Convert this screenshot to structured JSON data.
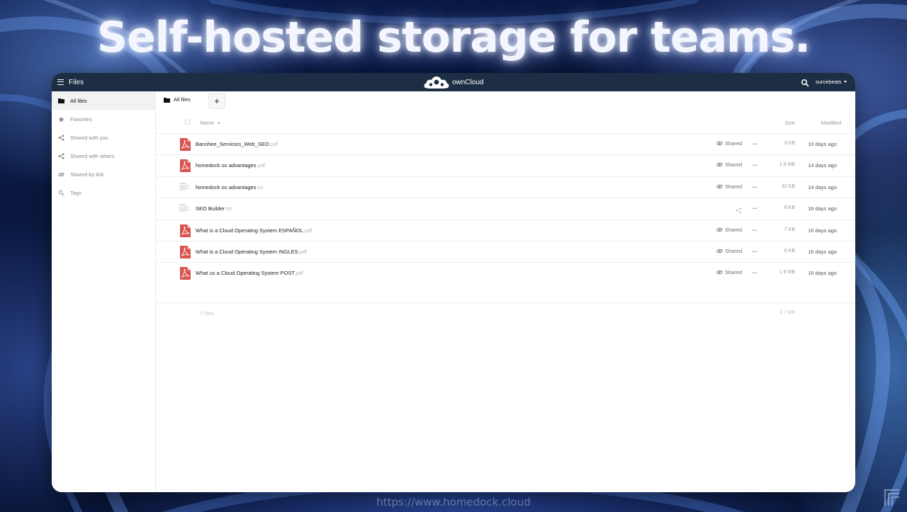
{
  "headline": "Self-hosted storage for teams.",
  "footer_url": "https://www.homedock.cloud",
  "colors": {
    "topbar": "#1d2d44",
    "pdf_red": "#d9534f",
    "background": "#0a1840"
  },
  "topbar": {
    "app_title": "Files",
    "brand": "ownCloud",
    "user": "surcebeats",
    "icons": [
      "menu-icon",
      "owncloud-logo-icon",
      "search-icon",
      "caret-down-icon"
    ]
  },
  "sidebar": {
    "items": [
      {
        "label": "All files",
        "icon": "folder-icon",
        "active": true
      },
      {
        "label": "Favorites",
        "icon": "star-icon",
        "active": false
      },
      {
        "label": "Shared with you",
        "icon": "share-icon",
        "active": false
      },
      {
        "label": "Shared with others",
        "icon": "share-icon",
        "active": false
      },
      {
        "label": "Shared by link",
        "icon": "link-icon",
        "active": false
      },
      {
        "label": "Tags",
        "icon": "tag-icon",
        "active": false
      }
    ]
  },
  "controls": {
    "breadcrumb": "All files",
    "add_label": "+"
  },
  "list": {
    "columns": {
      "name": "Name",
      "size": "Size",
      "modified": "Modified"
    },
    "files": [
      {
        "name": "Banshee_Servicios_Web_SEO",
        "ext": ".pdf",
        "type": "pdf",
        "shared": "Shared",
        "size": "3 KB",
        "modified": "10 days ago"
      },
      {
        "name": "homedock os advantages",
        "ext": ".pdf",
        "type": "pdf",
        "shared": "Shared",
        "size": "1.8 MB",
        "modified": "14 days ago"
      },
      {
        "name": "homedock os advantages",
        "ext": ".txt",
        "type": "txt",
        "shared": "Shared",
        "size": "32 KB",
        "modified": "14 days ago"
      },
      {
        "name": "SEO Builder",
        "ext": ".txt",
        "type": "txt",
        "shared": "",
        "size": "8 KB",
        "modified": "16 days ago"
      },
      {
        "name": "What is a Cloud Operating System ESPAÑOL",
        "ext": ".pdf",
        "type": "pdf",
        "shared": "Shared",
        "size": "7 KB",
        "modified": "16 days ago"
      },
      {
        "name": "What is a Cloud Operating System INGLES",
        "ext": ".pdf",
        "type": "pdf",
        "shared": "Shared",
        "size": "6 KB",
        "modified": "16 days ago"
      },
      {
        "name": "What us a Cloud Operating System POST",
        "ext": ".pdf",
        "type": "pdf",
        "shared": "Shared",
        "size": "1.9 MB",
        "modified": "16 days ago"
      }
    ],
    "summary": {
      "count": "7 files",
      "total": "3.7 MB"
    }
  }
}
